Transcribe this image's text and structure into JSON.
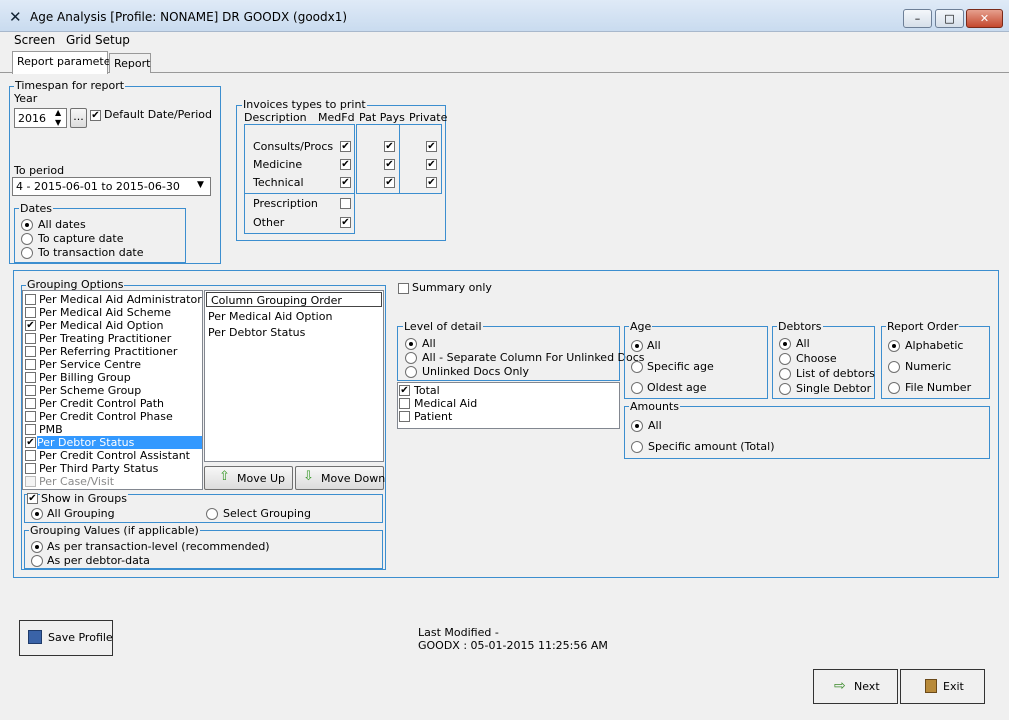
{
  "window": {
    "title": "Age Analysis  [Profile: NONAME] DR GOODX (goodx1)",
    "min_label": "–",
    "max_label": "□",
    "close_label": "✕"
  },
  "menu": {
    "screen": "Screen",
    "grid_setup": "Grid Setup"
  },
  "tabs": {
    "report_parameters": "Report parameters",
    "report": "Report"
  },
  "timespan": {
    "group_label": "Timespan for report",
    "year_label": "Year",
    "year_value": "2016",
    "ellipsis": "...",
    "default_date_label": "Default Date/Period",
    "to_period_label": "To period",
    "to_period_value": "4  - 2015-06-01 to 2015-06-30"
  },
  "dates": {
    "group_label": "Dates",
    "options": [
      "All dates",
      "To capture date",
      "To transaction date"
    ]
  },
  "invoices": {
    "group_label": "Invoices types to print",
    "col_description": "Description",
    "col_medfd": "MedFd",
    "col_pat_pays": "Pat Pays",
    "col_private": "Private",
    "rows": [
      "Consults/Procs",
      "Medicine",
      "Technical"
    ],
    "extra_rows": [
      "Prescription",
      "Other"
    ]
  },
  "grouping": {
    "group_label": "Grouping Options",
    "items": [
      "Per Medical Aid Administrator",
      "Per Medical Aid Scheme",
      "Per Medical Aid Option",
      "Per Treating Practitioner",
      "Per Referring Practitioner",
      "Per Service Centre",
      "Per Billing Group",
      "Per Scheme Group",
      "Per Credit Control Path",
      "Per Credit Control Phase",
      "PMB",
      "Per Debtor Status",
      "Per Credit Control Assistant",
      "Per Third Party Status",
      "Per Case/Visit"
    ],
    "order_header": "Column Grouping Order",
    "order_items": [
      "Per Medical Aid Option",
      "Per Debtor Status"
    ],
    "move_up": "Move Up",
    "move_down": "Move Down",
    "show_in_groups": "Show in Groups",
    "all_grouping": "All Grouping",
    "select_grouping": "Select Grouping",
    "values_label": "Grouping Values (if applicable)",
    "values_options": [
      "As per transaction-level (recommended)",
      "As per debtor-data"
    ]
  },
  "summary_only": "Summary only",
  "level": {
    "group_label": "Level of detail",
    "options": [
      "All",
      "All - Separate Column For Unlinked Docs",
      "Unlinked Docs Only"
    ],
    "checks": [
      "Total",
      "Medical Aid",
      "Patient"
    ]
  },
  "age": {
    "group_label": "Age",
    "options": [
      "All",
      "Specific age",
      "Oldest age"
    ]
  },
  "debtors": {
    "group_label": "Debtors",
    "options": [
      "All",
      "Choose",
      "List of debtors",
      "Single Debtor"
    ]
  },
  "report_order": {
    "group_label": "Report Order",
    "options": [
      "Alphabetic",
      "Numeric",
      "File Number"
    ]
  },
  "amounts": {
    "group_label": "Amounts",
    "options": [
      "All",
      "Specific amount (Total)"
    ]
  },
  "save_profile": "Save Profile",
  "last_modified": {
    "line1": "Last Modified -",
    "line2": "GOODX : 05-01-2015 11:25:56 AM"
  },
  "next": "Next",
  "exit": "Exit",
  "colors": {
    "group_border": "#3c8ecf",
    "selection": "#3399ff",
    "titlebar": "#dfeaf7"
  }
}
